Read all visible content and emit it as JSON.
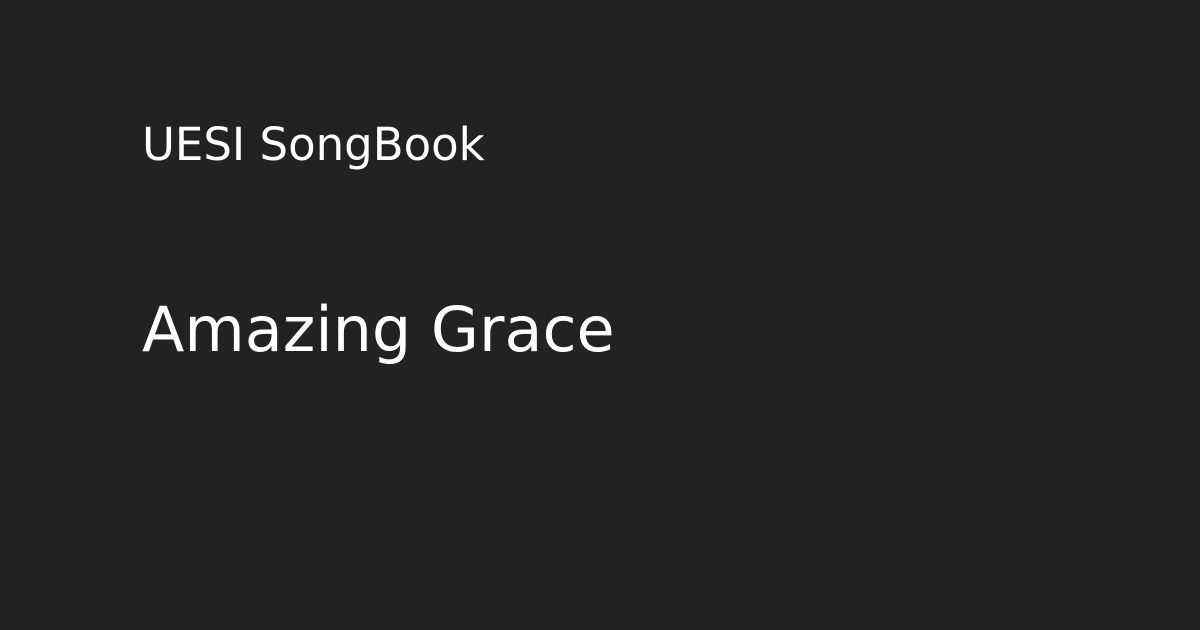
{
  "card": {
    "site_name": "UESI SongBook",
    "song_title": "Amazing Grace"
  },
  "colors": {
    "background": "#222222",
    "text": "#ffffff"
  }
}
